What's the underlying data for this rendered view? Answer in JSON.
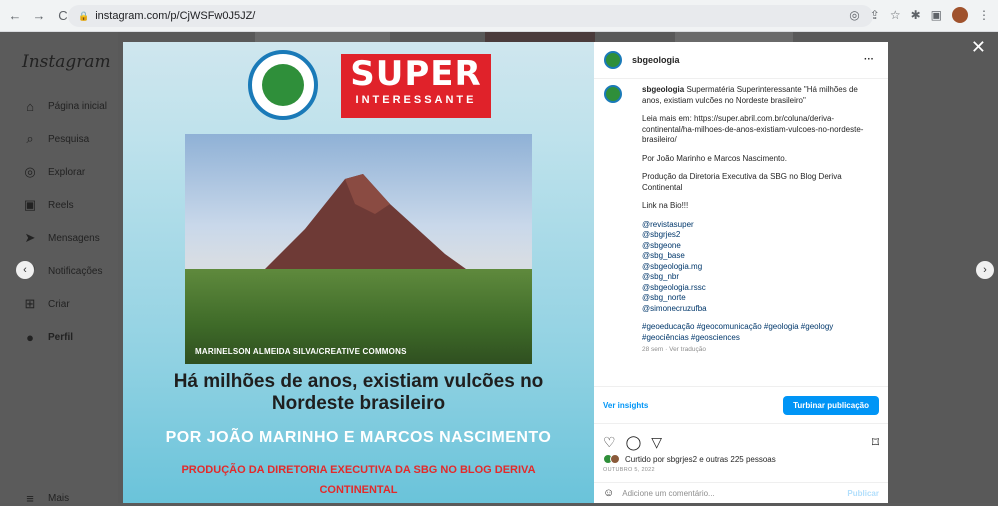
{
  "browser": {
    "url": "instagram.com/p/CjWSFw0J5JZ/",
    "back_icon": "←",
    "forward_icon": "→",
    "reload_icon": "C"
  },
  "sidebar": {
    "logo": "Instagram",
    "items": [
      {
        "label": "Página inicial",
        "icon": "⌂"
      },
      {
        "label": "Pesquisa",
        "icon": "⌕"
      },
      {
        "label": "Explorar",
        "icon": "◎"
      },
      {
        "label": "Reels",
        "icon": "▣"
      },
      {
        "label": "Mensagens",
        "icon": "➤"
      },
      {
        "label": "Notificações",
        "icon": "♡"
      },
      {
        "label": "Criar",
        "icon": "⊞"
      },
      {
        "label": "Perfil",
        "icon": "●"
      },
      {
        "label": "Mais",
        "icon": "≡"
      }
    ]
  },
  "modal": {
    "close_icon": "✕",
    "prev_icon": "‹",
    "next_icon": "›"
  },
  "post_image": {
    "super_title": "SUPER",
    "super_subtitle": "INTERESSANTE",
    "photo_credit": "MARINELSON ALMEIDA SILVA/CREATIVE COMMONS",
    "headline": "Há milhões de anos, existiam vulcões no Nordeste brasileiro",
    "authors": "POR JOÃO MARINHO E MARCOS NASCIMENTO",
    "production": "PRODUÇÃO DA DIRETORIA EXECUTIVA DA SBG NO BLOG DERIVA CONTINENTAL"
  },
  "panel": {
    "username": "sbgeologia",
    "more_icon": "···",
    "caption_intro": "Supermatéria Superinteressante \"Há milhões de anos, existiam vulcões no Nordeste brasileiro\"",
    "caption_link": "Leia mais em: https://super.abril.com.br/coluna/deriva-continental/ha-milhoes-de-anos-existiam-vulcoes-no-nordeste-brasileiro/",
    "caption_authors": "Por João Marinho e Marcos Nascimento.",
    "caption_production": "Produção da Diretoria Executiva da SBG no Blog Deriva Continental",
    "caption_bio": "Link na Bio!!!",
    "mentions": [
      "@revistasuper",
      "@sbgrjes2",
      "@sbgeone",
      "@sbg_base",
      "@sbgeologia.mg",
      "@sbg_nbr",
      "@sbgeologia.rssc",
      "@sbg_norte",
      "@simonecruzufba"
    ],
    "hashtags": "#geoeducação #geocomunicação #geologia #geology #geociências #geosciences",
    "caption_meta": "28 sem · Ver tradução",
    "insights_label": "Ver insights",
    "boost_label": "Turbinar publicação",
    "likes_text": "Curtido por sbgrjes2 e outras 225 pessoas",
    "date": "OUTUBRO 5, 2022",
    "comment_placeholder": "Adicione um comentário...",
    "publish_label": "Publicar"
  }
}
